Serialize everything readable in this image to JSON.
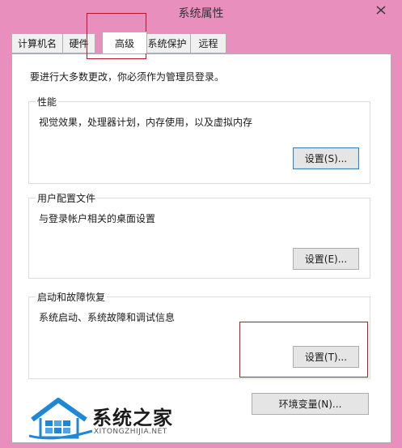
{
  "window": {
    "title": "系统属性",
    "close_icon": "close-icon"
  },
  "tabs": [
    {
      "label": "计算机名",
      "active": false
    },
    {
      "label": "硬件",
      "active": false
    },
    {
      "label": "高级",
      "active": true
    },
    {
      "label": "系统保护",
      "active": false
    },
    {
      "label": "远程",
      "active": false
    }
  ],
  "panel": {
    "note": "要进行大多数更改，你必须作为管理员登录。",
    "performance": {
      "title": "性能",
      "description": "视觉效果，处理器计划，内存使用，以及虚拟内存",
      "button": "设置(S)..."
    },
    "user_profiles": {
      "title": "用户配置文件",
      "description": "与登录帐户相关的桌面设置",
      "button": "设置(E)..."
    },
    "startup_recovery": {
      "title": "启动和故障恢复",
      "description": "系统启动、系统故障和调试信息",
      "button": "设置(T)..."
    },
    "env_button": "环境变量(N)..."
  },
  "watermark": {
    "text": "系统之家",
    "url": "XITONGZHIJIA.NET"
  },
  "colors": {
    "window_frame": "#e88fbd",
    "highlight_box": "#c0142a",
    "watermark_blue": "#1e88d6"
  }
}
